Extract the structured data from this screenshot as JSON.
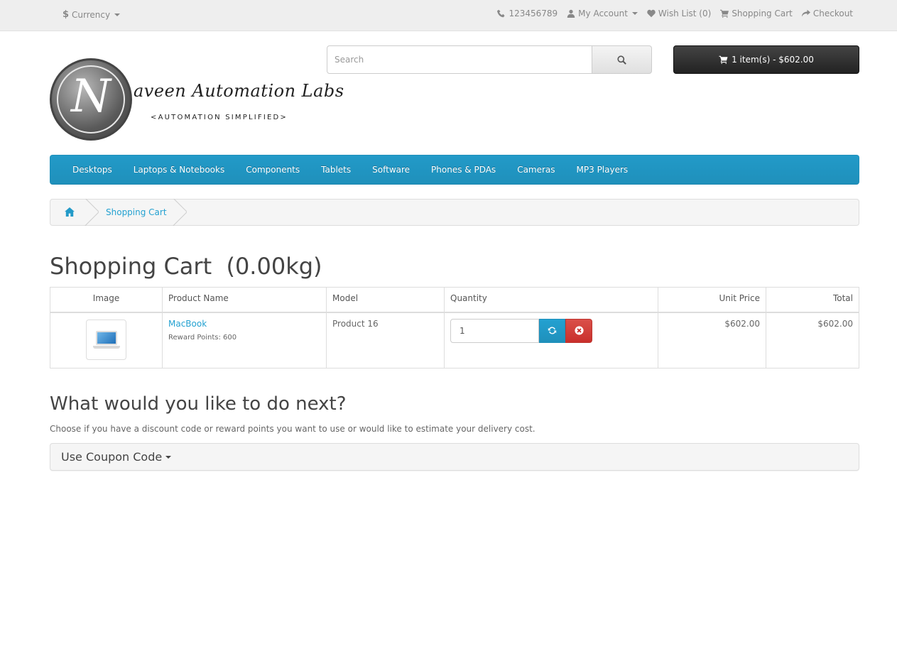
{
  "topbar": {
    "currency_symbol": "$",
    "currency_label": "Currency",
    "phone": "123456789",
    "my_account": "My Account",
    "wish_list": "Wish List (0)",
    "shopping_cart": "Shopping Cart",
    "checkout": "Checkout"
  },
  "logo": {
    "letter": "N",
    "script": "aveen Automation Labs",
    "tagline": "<AUTOMATION SIMPLIFIED>"
  },
  "search": {
    "placeholder": "Search",
    "icon": "search-icon"
  },
  "cart_button": {
    "label": "1 item(s) - $602.00",
    "icon": "cart-icon"
  },
  "menu": {
    "items": [
      "Desktops",
      "Laptops & Notebooks",
      "Components",
      "Tablets",
      "Software",
      "Phones & PDAs",
      "Cameras",
      "MP3 Players"
    ]
  },
  "breadcrumb": {
    "home_icon": "home-icon",
    "current": "Shopping Cart"
  },
  "page_title": "Shopping Cart  (0.00kg)",
  "cart_table": {
    "headers": {
      "image": "Image",
      "name": "Product Name",
      "model": "Model",
      "quantity": "Quantity",
      "unit_price": "Unit Price",
      "total": "Total"
    },
    "rows": [
      {
        "name": "MacBook",
        "reward": "Reward Points: 600",
        "model": "Product 16",
        "quantity": "1",
        "unit_price": "$602.00",
        "total": "$602.00"
      }
    ]
  },
  "next": {
    "title": "What would you like to do next?",
    "description": "Choose if you have a discount code or reward points you want to use or would like to estimate your delivery cost.",
    "coupon_label": "Use Coupon Code"
  },
  "colors": {
    "accent": "#229ac8",
    "link": "#23a1d1",
    "danger": "#da4f49",
    "dark_button": "#333333"
  }
}
